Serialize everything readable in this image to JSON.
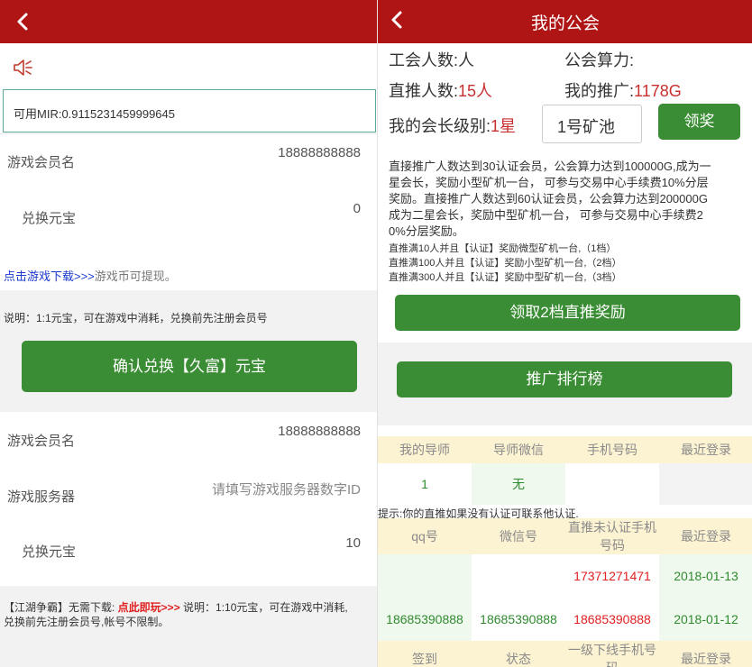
{
  "left": {
    "mir_balance": "可用MIR:0.9115231459999645",
    "section1": {
      "member_label": "游戏会员名",
      "member_value": "18888888888",
      "exchange_label": "兑换元宝",
      "exchange_value": "0",
      "download_link": "点击游戏下载>>>",
      "download_suffix": "游戏币可提现。",
      "note": "说明：1:1元宝，可在游戏中消耗，兑换前先注册会员号",
      "confirm_label": "确认兑换【久富】元宝"
    },
    "section2": {
      "member_label": "游戏会员名",
      "member_value": "18888888888",
      "server_label": "游戏服务器",
      "server_placeholder": "请填写游戏服务器数字ID",
      "exchange_label": "兑换元宝",
      "exchange_value": "10",
      "note_prefix": "【江湖争霸】无需下载: ",
      "note_link": "点此即玩>>>",
      "note_rest": " 说明：1:10元宝，可在游戏中消耗,",
      "note_line2": "兑换前先注册会员号,帐号不限制。"
    }
  },
  "right": {
    "title": "我的公会",
    "guild_count_label": "工会人数:",
    "guild_count_unit": "人",
    "guild_power_label": "公会算力:",
    "direct_label": "直推人数:",
    "direct_value": "15人",
    "promo_label": "我的推广:",
    "promo_value": "1178G",
    "level_label": "我的会长级别:",
    "level_value": "1星",
    "pool_value": "1号矿池",
    "claim_label": "领奖",
    "desc": [
      "直接推广人数达到30认证会员，公会算力达到100000G,成为一",
      "星会长，奖励小型矿机一台，  可参与交易中心手续费10%分层",
      "奖励。直接推广人数达到60认证会员，公会算力达到200000G",
      "成为二星会长，奖励中型矿机一台，  可参与交易中心手续费2",
      "0%分层奖励。"
    ],
    "tiers": [
      "直推满10人并且【认证】奖励微型矿机一台,（1档）",
      "直推满100人并且【认证】奖励小型矿机一台,（2档）",
      "直推满300人并且【认证】奖励中型矿机一台,（3档）"
    ],
    "claim_direct_label": "领取2档直推奖励",
    "ranking_label": "推广排行榜",
    "mentor_table": {
      "headers": [
        "我的导师",
        "导师微信",
        "手机号码",
        "最近登录"
      ],
      "row": [
        "1",
        "无",
        "",
        ""
      ]
    },
    "hint": "提示:你的直推如果没有认证可联系他认证.",
    "direct_table": {
      "headers": [
        "qq号",
        "微信号",
        "直推未认证手机号码",
        "最近登录"
      ],
      "rows": [
        [
          "",
          "",
          "17371271471",
          "2018-01-13"
        ],
        [
          "18685390888",
          "18685390888",
          "18685390888",
          "2018-01-12"
        ]
      ]
    },
    "sign_table": {
      "headers": [
        "签到",
        "状态",
        "一级下线手机号码",
        "最近登录"
      ]
    }
  },
  "colors": {
    "header_red": "#b01515",
    "button_green": "#3a8d34",
    "value_red": "#c83030",
    "table_header_bg": "#fcf3d3"
  }
}
